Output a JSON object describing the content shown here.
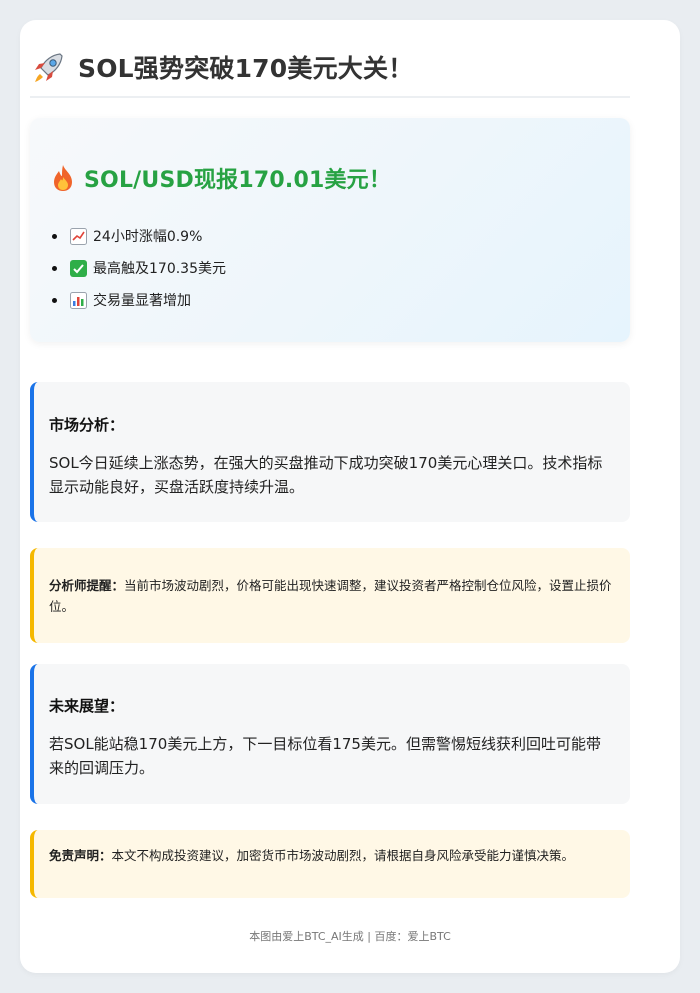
{
  "header": {
    "icon": "rocket-icon",
    "title": "SOL强势突破170美元大关！"
  },
  "price_box": {
    "icon": "fire-icon",
    "title": "SOL/USD现报170.01美元！",
    "items": [
      {
        "icon": "chart-increasing-icon",
        "text": "24小时涨幅0.9%"
      },
      {
        "icon": "check-mark-icon",
        "text": "最高触及170.35美元"
      },
      {
        "icon": "bar-chart-icon",
        "text": "交易量显著增加"
      }
    ]
  },
  "market_analysis": {
    "heading": "市场分析：",
    "body": "SOL今日延续上涨态势，在强大的买盘推动下成功突破170美元心理关口。技术指标显示动能良好，买盘活跃度持续升温。"
  },
  "analyst_alert": {
    "label": "分析师提醒：",
    "text": "当前市场波动剧烈，价格可能出现快速调整，建议投资者严格控制仓位风险，设置止损价位。"
  },
  "outlook": {
    "heading": "未来展望：",
    "body": "若SOL能站稳170美元上方，下一目标位看175美元。但需警惕短线获利回吐可能带来的回调压力。"
  },
  "disclaimer": {
    "label": "免责声明：",
    "text": "本文不构成投资建议，加密货币市场波动剧烈，请根据自身风险承受能力谨慎决策。"
  },
  "footer": {
    "text": "本图由爱上BTC_AI生成 | 百度：爱上BTC"
  },
  "colors": {
    "accent_blue": "#1a73e8",
    "accent_green": "#27a243",
    "warn_yellow": "#f5b800",
    "warn_bg": "#fff8e6"
  }
}
